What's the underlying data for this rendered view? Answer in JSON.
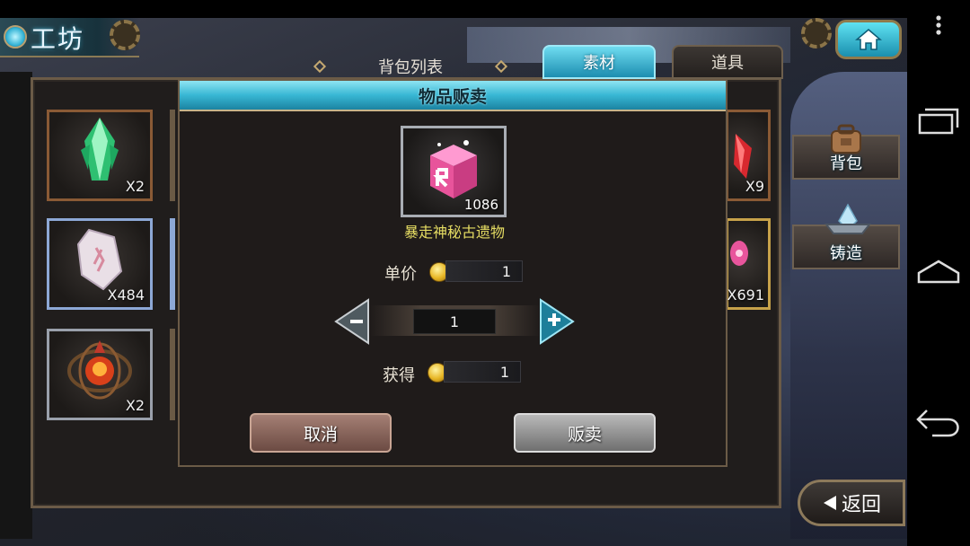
{
  "header": {
    "title": "工坊"
  },
  "panel": {
    "list_title": "背包列表",
    "tabs": [
      {
        "label": "素材",
        "active": true
      },
      {
        "label": "道具",
        "active": false
      }
    ]
  },
  "inventory": {
    "left_items": [
      {
        "icon": "green-crystal-icon",
        "qty": "X2"
      },
      {
        "icon": "rune-stone-icon",
        "qty": "X484"
      },
      {
        "icon": "flame-orb-icon",
        "qty": "X2"
      }
    ],
    "right_items": [
      {
        "icon": "red-crystal-icon",
        "qty": "X9"
      },
      {
        "icon": "pink-ribbon-icon",
        "qty": "X691"
      }
    ]
  },
  "dialog": {
    "title": "物品贩卖",
    "item": {
      "icon": "pink-relic-box-icon",
      "count": "1086",
      "name": "暴走神秘古遗物"
    },
    "unit_price_label": "单价",
    "unit_price": "1",
    "quantity": "1",
    "earn_label": "获得",
    "earn_value": "1",
    "cancel_label": "取消",
    "sell_label": "贩卖"
  },
  "side_menu": {
    "backpack_label": "背包",
    "forge_label": "铸造"
  },
  "back_label": "返回",
  "colors": {
    "accent_cyan": "#38b7d4",
    "item_name_yellow": "#e6dd63",
    "cancel_button": "#6c4b43",
    "sell_button": "#6f6f6f"
  }
}
